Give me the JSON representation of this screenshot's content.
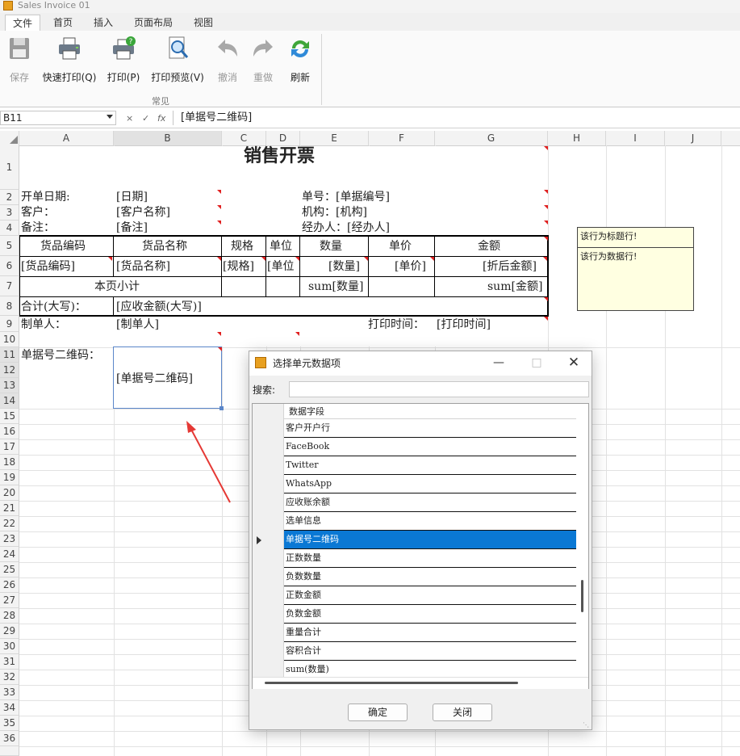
{
  "window": {
    "title": "Sales Invoice 01"
  },
  "tabs": [
    {
      "label": "文件",
      "active": true
    },
    {
      "label": "首页",
      "active": false
    },
    {
      "label": "插入",
      "active": false
    },
    {
      "label": "页面布局",
      "active": false
    },
    {
      "label": "视图",
      "active": false
    }
  ],
  "ribbon": {
    "buttons": [
      {
        "label": "保存",
        "icon": "save-icon",
        "enabled": false
      },
      {
        "label": "快速打印(Q)",
        "icon": "printer-icon",
        "enabled": true
      },
      {
        "label": "打印(P)",
        "icon": "printer-help-icon",
        "enabled": true
      },
      {
        "label": "打印预览(V)",
        "icon": "print-preview-icon",
        "enabled": true
      },
      {
        "label": "撤消",
        "icon": "undo-icon",
        "enabled": false
      },
      {
        "label": "重做",
        "icon": "redo-icon",
        "enabled": false
      },
      {
        "label": "刷新",
        "icon": "refresh-icon",
        "enabled": true
      }
    ],
    "group_label": "常见"
  },
  "formula_bar": {
    "cell_ref": "B11",
    "icons": [
      "×",
      "✓",
      "fx"
    ],
    "value": "[单据号二维码]"
  },
  "sheet": {
    "columns": [
      "A",
      "B",
      "C",
      "D",
      "E",
      "F",
      "G",
      "H",
      "I",
      "J"
    ],
    "selected_column": "B",
    "rows": [
      "1",
      "2",
      "3",
      "4",
      "5",
      "6",
      "7",
      "8",
      "9",
      "10",
      "11",
      "12",
      "13",
      "14",
      "15",
      "16",
      "17",
      "18",
      "19",
      "20",
      "21",
      "22",
      "23",
      "24",
      "25",
      "26",
      "27",
      "28",
      "29",
      "30",
      "31",
      "32",
      "33",
      "34",
      "35",
      "36"
    ],
    "selected_rows": [
      "11",
      "12",
      "13",
      "14"
    ],
    "title": "销售开票",
    "r2_a": "开单日期:",
    "r2_b": "[日期]",
    "r2_e": "单号：[单据编号]",
    "r3_a": "客户：",
    "r3_b": "[客户名称]",
    "r3_e": "机构：[机构]",
    "r4_a": "备注：",
    "r4_b": "[备注]",
    "r4_e": "经办人：[经办人]",
    "header": [
      "货品编码",
      "货品名称",
      "规格",
      "单位",
      "数量",
      "单价",
      "金额"
    ],
    "datarow": [
      "[货品编码]",
      "[货品名称]",
      "[规格]",
      "[单位",
      "[数量]",
      "[单价]",
      "[折后金额]"
    ],
    "subtotal_label": "本页小计",
    "subtotal_qty": "sum[数量]",
    "subtotal_amt": "sum[金额]",
    "r8_a": "合计(大写)：",
    "r8_b": "[应收金额(大写)]",
    "r9_a": "制单人：",
    "r9_b": "[制单人]",
    "r9_f": "打印时间：",
    "r9_g": "[打印时间]",
    "r11_a": "单据号二维码：",
    "r11_b": "[单据号二维码]",
    "note_title_row": "该行为标题行!",
    "note_data_row": "该行为数据行!"
  },
  "dialog": {
    "title": "选择单元数据项",
    "search_label": "搜索:",
    "search_value": "",
    "column_header": "数据字段",
    "items": [
      "客户开户行",
      "FaceBook",
      "Twitter",
      "WhatsApp",
      "应收账余额",
      "选单信息",
      "单据号二维码",
      "正数数量",
      "负数数量",
      "正数金额",
      "负数金额",
      "重量合计",
      "容积合计",
      "sum(数量)"
    ],
    "selected_item": "单据号二维码",
    "ok_label": "确定",
    "close_label": "关闭"
  },
  "colors": {
    "accent": "#0a78d4",
    "note_bg": "#ffffe1",
    "annotation_arrow": "#e53935"
  }
}
